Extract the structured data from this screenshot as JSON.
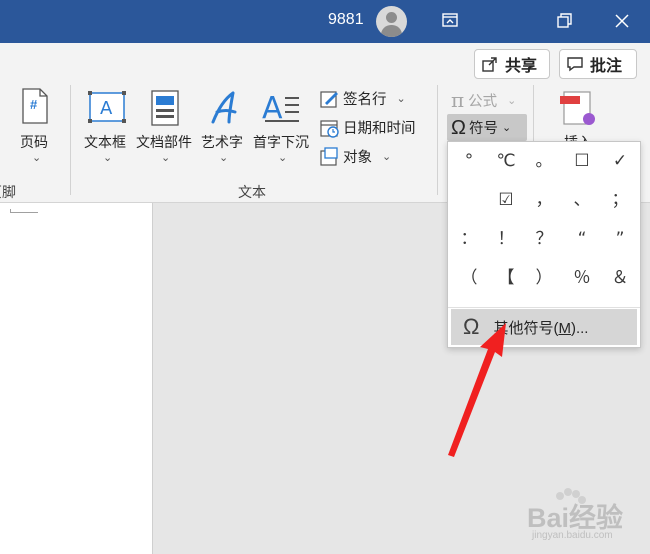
{
  "titlebar": {
    "user_id": "9881",
    "buttons": [
      "ribbon-display-icon",
      "restore-icon",
      "close-icon"
    ]
  },
  "ribbon": {
    "share_label": "共享",
    "comments_label": "批注",
    "page_number": {
      "label": "页码",
      "icon_char": "#"
    },
    "header_footer_cut": "页脚",
    "textbox_label": "文本框",
    "quickparts_label": "文档部件",
    "wordart_label": "艺术字",
    "dropcap_label": "首字下沉",
    "signature_label": "签名行",
    "datetime_label": "日期和时间",
    "object_label": "对象",
    "equation_label": "公式",
    "symbol_label": "符号",
    "insert_label": "插入",
    "text_group_label": "文本",
    "equation_icon": "π"
  },
  "symbol_menu": {
    "symbols": [
      "°",
      "℃",
      "。",
      "☐",
      "✓",
      "",
      "☑",
      "，",
      "、",
      "；",
      "：",
      "！",
      "？",
      "“",
      "”",
      "（",
      "【",
      "）",
      "％",
      "＆"
    ],
    "more_label_prefix": "其他符号(",
    "more_label_key": "M",
    "more_label_suffix": ")...",
    "omega": "Ω"
  },
  "watermark": {
    "brand": "Bai经验",
    "url": "jingyan.baidu.com"
  },
  "colors": {
    "titlebar": "#2b579a",
    "ribbon": "#f3f3f3",
    "accent_blue": "#2b7cd3",
    "arrow_red": "#f02020"
  }
}
